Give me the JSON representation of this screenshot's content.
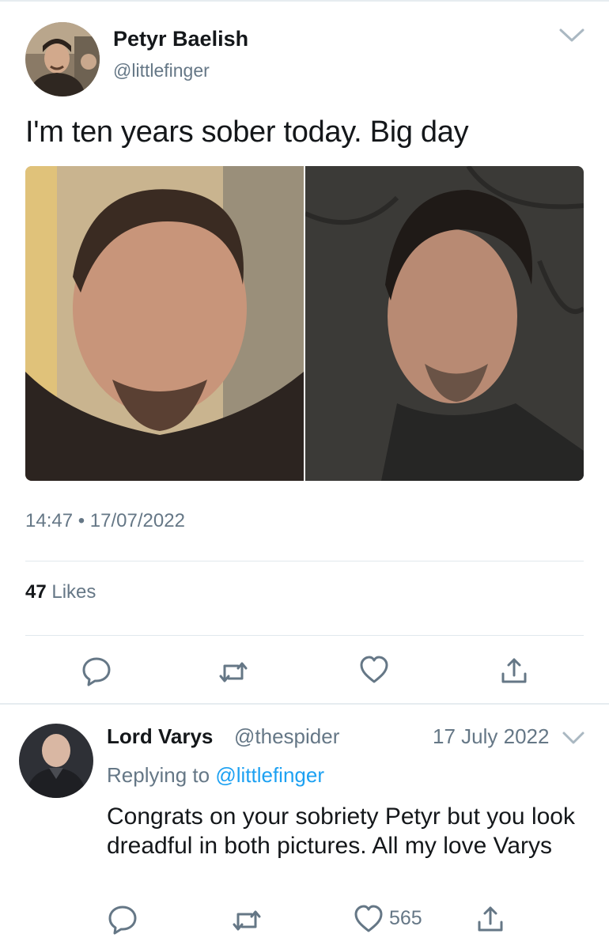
{
  "tweet": {
    "author_name": "Petyr Baelish",
    "author_handle": "@littlefinger",
    "text": "I'm ten years sober today. Big day",
    "timestamp": "14:47 • 17/07/2022",
    "likes_count": "47",
    "likes_label": "Likes",
    "actions": [
      "reply-icon",
      "retweet-icon",
      "like-icon",
      "share-icon"
    ]
  },
  "reply": {
    "author_name": "Lord Varys",
    "author_handle": "@thespider",
    "date": "17 July 2022",
    "replying_prefix": "Replying to",
    "replying_mention": "@littlefinger",
    "text": "Congrats on your sobriety Petyr but you look dreadful in both pictures. All my love Varys",
    "like_count": "565",
    "actions": [
      "reply-icon",
      "retweet-icon",
      "like-icon",
      "share-icon"
    ]
  },
  "colors": {
    "text_primary": "#14171a",
    "text_secondary": "#657786",
    "link": "#1da1f2",
    "divider": "#e1e8ed"
  }
}
